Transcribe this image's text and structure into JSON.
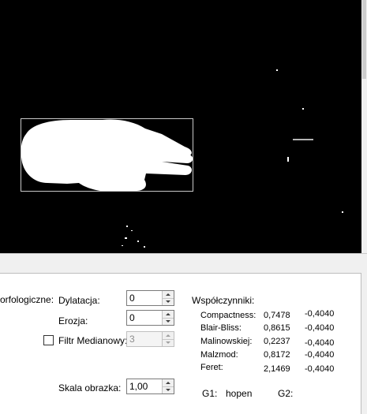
{
  "image_panel": {
    "scrollbar": {
      "thumb_fraction": 0.31
    }
  },
  "morph": {
    "group_label": "orfologiczne:",
    "dilation_label": "Dylatacja:",
    "dilation_value": "0",
    "erosion_label": "Erozja:",
    "erosion_value": "0",
    "median_label": "Filtr Medianowy:",
    "median_value": "3",
    "median_checked": false,
    "scale_label": "Skala obrazka:",
    "scale_value": "1,00"
  },
  "coefficients": {
    "title": "Współczynniki:",
    "rows": [
      {
        "name": "Compactness:",
        "value": "0,7478",
        "ref": "-0,4040"
      },
      {
        "name": "Blair-Bliss:",
        "value": "0,8615",
        "ref": "-0,4040"
      },
      {
        "name": "Malinowskiej:",
        "value": "0,2237",
        "ref": "-0,4040"
      },
      {
        "name": "Malzmod:",
        "value": "0,8172",
        "ref": "-0,4040"
      },
      {
        "name": "Feret:",
        "value": "2,1469",
        "ref": "-0,4040"
      }
    ]
  },
  "gestures": {
    "g1_label": "G1:",
    "g1_value": "hopen",
    "g2_label": "G2:",
    "g2_value": ""
  }
}
